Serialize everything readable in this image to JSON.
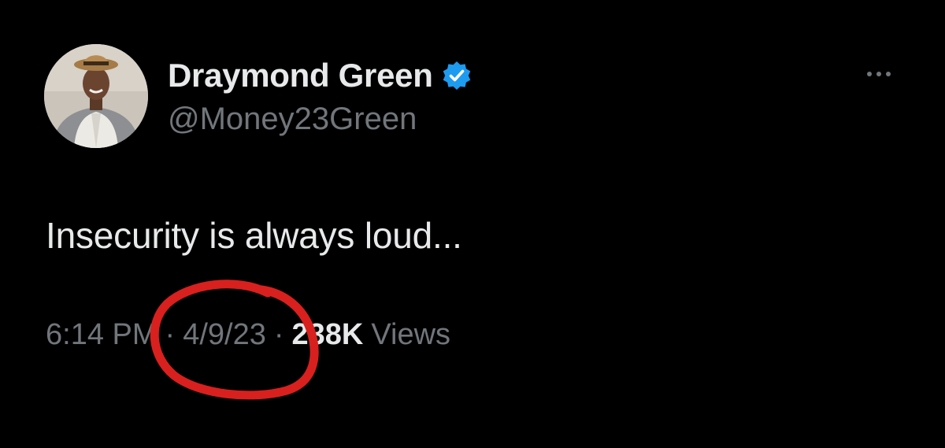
{
  "author": {
    "display_name": "Draymond Green",
    "handle": "@Money23Green",
    "verified": true,
    "verified_icon": "verified-badge-icon"
  },
  "more_icon": "more-horizontal-icon",
  "tweet": {
    "text": "Insecurity is always loud...",
    "time": "6:14 PM",
    "date": "4/9/23",
    "separator": "·",
    "views_count": "238K",
    "views_label": "Views"
  },
  "colors": {
    "background": "#000000",
    "primary_text": "#e7e9ea",
    "secondary_text": "#71767b",
    "verified_blue": "#1d9bf0",
    "annotation_red": "#d8201e"
  }
}
